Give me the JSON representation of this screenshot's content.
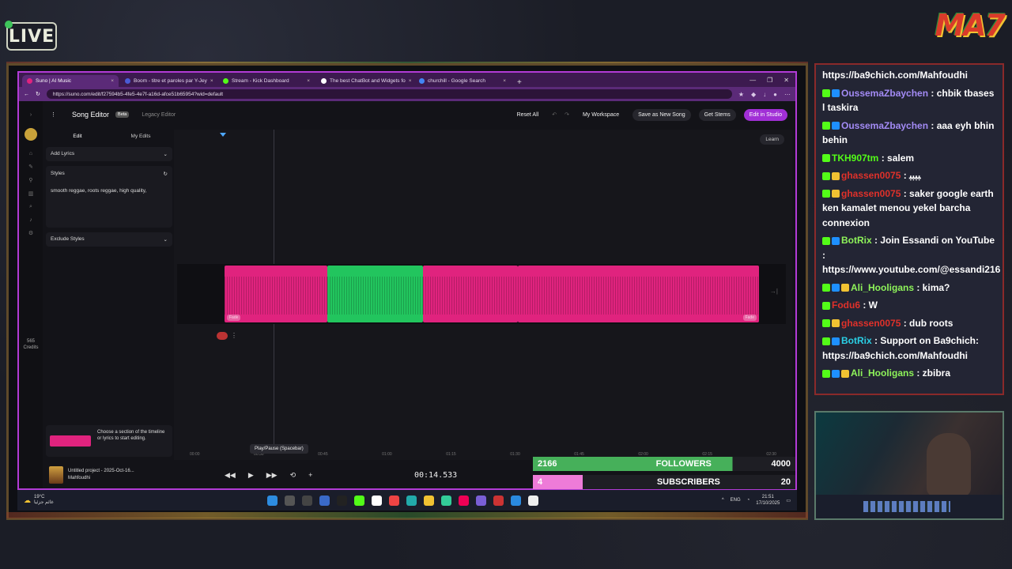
{
  "overlay": {
    "live_label": "LIVE",
    "brand_logo": "MA7",
    "followers": {
      "current": "2166",
      "label": "FOLLOWERS",
      "goal": "4000"
    },
    "subscribers": {
      "current": "4",
      "label": "SUBSCRIBERS",
      "goal": "20"
    }
  },
  "browser": {
    "tabs": [
      {
        "title": "Suno | AI Music",
        "color": "#e0237e",
        "active": true
      },
      {
        "title": "Boom - titre et paroles par Y-Jey",
        "color": "#4a5bd6",
        "active": false
      },
      {
        "title": "Stream - Kick Dashboard",
        "color": "#53fc18",
        "active": false
      },
      {
        "title": "The best ChatBot and Widgets fo",
        "color": "#ffffff",
        "active": false
      },
      {
        "title": "churchill - Google Search",
        "color": "#4285f4",
        "active": false
      }
    ],
    "new_tab": "+",
    "url": "https://suno.com/edit/f27594b5-4fe5-4e7f-a16d-afce51b65954?wid=default"
  },
  "app": {
    "editor_title": "Song Editor",
    "beta": "Beta",
    "legacy": "Legacy Editor",
    "reset_all": "Reset All",
    "workspace": "My Workspace",
    "save_new": "Save as New Song",
    "get_stems": "Get Stems",
    "edit_studio": "Edit in Studio",
    "edit_tab": "Edit",
    "my_edits_tab": "My Edits",
    "add_lyrics": "Add Lyrics",
    "styles_label": "Styles",
    "styles_value": "smooth reggae, roots reggae, high quality,",
    "exclude_styles": "Exclude Styles",
    "credits_value": "565",
    "credits_label": "Credits",
    "hint": "Choose a section of the timeline or lyrics to start editing.",
    "learn": "Learn",
    "clip_tag_left": "Fade",
    "clip_tag_right": "Fade",
    "ruler": [
      "00:00",
      "00:30",
      "00:45",
      "01:00",
      "01:15",
      "01:30",
      "01:45",
      "02:00",
      "02:15",
      "02:30"
    ],
    "project_title": "Untitled project - 2025-Oct-16...",
    "project_user": "Mahfoudhi",
    "tooltip": "Play/Pause (Spacebar)",
    "time": "00:14.533"
  },
  "taskbar": {
    "temp": "19°C",
    "weather": "غائم جزئيا",
    "lang": "ENG",
    "time": "21:51",
    "date": "17/10/2025"
  },
  "chat": [
    {
      "user": "",
      "text": "https://ba9chich.com/Mahfoudhi",
      "color": "",
      "badges": []
    },
    {
      "user": "OussemaZbaychen",
      "text": " : chbik tbases l taskira",
      "color": "u-purple",
      "badges": [
        "b-green",
        "b-blue"
      ]
    },
    {
      "user": "OussemaZbaychen",
      "text": " : aaa eyh bhin behin",
      "color": "u-purple",
      "badges": [
        "b-green",
        "b-blue"
      ]
    },
    {
      "user": "TKH907tm",
      "text": " : salem",
      "color": "u-green",
      "badges": [
        "b-green"
      ]
    },
    {
      "user": "ghassen0075",
      "text": " : ﺒﺒﺒﺒ",
      "color": "u-red",
      "badges": [
        "b-green",
        "b-yellow"
      ]
    },
    {
      "user": "ghassen0075",
      "text": " : saker google earth ken kamalet menou yekel barcha connexion",
      "color": "u-red",
      "badges": [
        "b-green",
        "b-yellow"
      ]
    },
    {
      "user": "BotRix",
      "text": " : Join Essandi on YouTube : https://www.youtube.com/@essandi216",
      "color": "u-lime",
      "badges": [
        "b-green",
        "b-blue"
      ]
    },
    {
      "user": "Ali_Hooligans",
      "text": " : kima?",
      "color": "u-lime",
      "badges": [
        "b-green",
        "b-blue",
        "b-yellow"
      ]
    },
    {
      "user": "Fodu6",
      "text": " : W",
      "color": "u-red",
      "badges": [
        "b-green"
      ]
    },
    {
      "user": "ghassen0075",
      "text": " : dub roots",
      "color": "u-red",
      "badges": [
        "b-green",
        "b-yellow"
      ]
    },
    {
      "user": "BotRix",
      "text": " : Support on Ba9chich: https://ba9chich.com/Mahfoudhi",
      "color": "u-blue",
      "badges": [
        "b-green",
        "b-blue"
      ]
    },
    {
      "user": "Ali_Hooligans",
      "text": " : zbibra",
      "color": "u-lime",
      "badges": [
        "b-green",
        "b-blue",
        "b-yellow"
      ]
    }
  ]
}
